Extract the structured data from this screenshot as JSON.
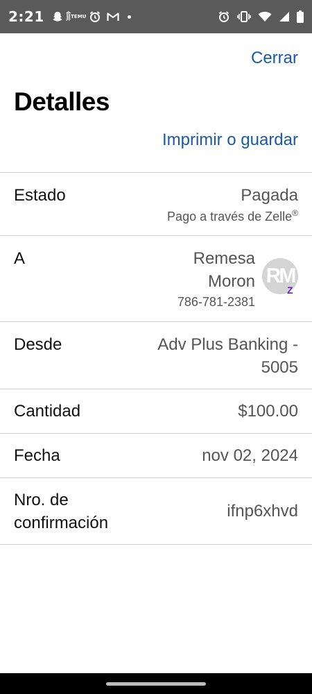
{
  "status_bar": {
    "time": "2:21",
    "temu_top": "合并",
    "temu_bottom": "TEMU",
    "icons_left": [
      "snapchat-icon",
      "temu-icon",
      "alarm-icon",
      "gmail-icon",
      "dot-icon"
    ],
    "icons_right": [
      "alarm-icon",
      "vibrate-icon",
      "wifi-icon",
      "signal-icon",
      "battery-icon"
    ]
  },
  "header": {
    "close_label": "Cerrar",
    "title": "Detalles",
    "print_label": "Imprimir o guardar"
  },
  "details": {
    "estado": {
      "label": "Estado",
      "value": "Pagada",
      "sub": "Pago a través de Zelle",
      "sub_mark": "®"
    },
    "a": {
      "label": "A",
      "name_line1": "Remesa",
      "name_line2": "Moron",
      "phone": "786-781-2381",
      "avatar_initials": "RM",
      "badge": "Z"
    },
    "desde": {
      "label": "Desde",
      "value_line1": "Adv Plus Banking -",
      "value_line2": "5005"
    },
    "cantidad": {
      "label": "Cantidad",
      "value": "$100.00"
    },
    "fecha": {
      "label": "Fecha",
      "value": "nov 02, 2024"
    },
    "confirmacion": {
      "label_line1": "Nro. de",
      "label_line2": "confirmación",
      "value": "ifnp6xhvd"
    }
  },
  "colors": {
    "link": "#1a5aa8",
    "status_bar": "#5a5a5a",
    "zelle": "#6d1ed4",
    "divider": "#cfcfcf"
  }
}
